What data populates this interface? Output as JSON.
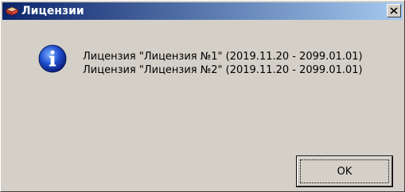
{
  "window": {
    "title": "Лицензии",
    "icon": "license-book-icon",
    "title_gradient_start": "#0a246a",
    "title_gradient_end": "#a6caf0",
    "face_color": "#d4d0c8"
  },
  "dialog": {
    "icon": "info-icon",
    "messages": [
      "Лицензия \"Лицензия №1\" (2019.11.20 - 2099.01.01)",
      "Лицензия \"Лицензия №2\" (2019.11.20 - 2099.01.01)"
    ],
    "ok_label": "OK",
    "close_icon": "close-icon"
  }
}
